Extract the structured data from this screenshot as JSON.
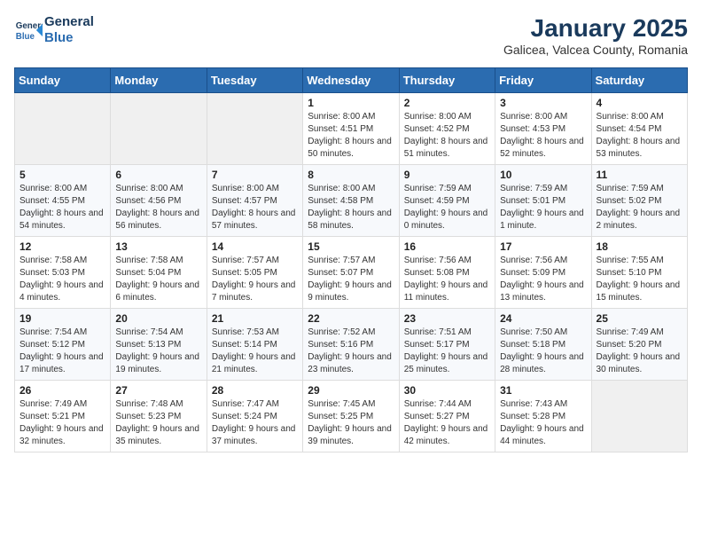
{
  "header": {
    "logo_line1": "General",
    "logo_line2": "Blue",
    "month": "January 2025",
    "location": "Galicea, Valcea County, Romania"
  },
  "weekdays": [
    "Sunday",
    "Monday",
    "Tuesday",
    "Wednesday",
    "Thursday",
    "Friday",
    "Saturday"
  ],
  "weeks": [
    [
      {
        "day": "",
        "sunrise": "",
        "sunset": "",
        "daylight": ""
      },
      {
        "day": "",
        "sunrise": "",
        "sunset": "",
        "daylight": ""
      },
      {
        "day": "",
        "sunrise": "",
        "sunset": "",
        "daylight": ""
      },
      {
        "day": "1",
        "sunrise": "8:00 AM",
        "sunset": "4:51 PM",
        "daylight": "8 hours and 50 minutes."
      },
      {
        "day": "2",
        "sunrise": "8:00 AM",
        "sunset": "4:52 PM",
        "daylight": "8 hours and 51 minutes."
      },
      {
        "day": "3",
        "sunrise": "8:00 AM",
        "sunset": "4:53 PM",
        "daylight": "8 hours and 52 minutes."
      },
      {
        "day": "4",
        "sunrise": "8:00 AM",
        "sunset": "4:54 PM",
        "daylight": "8 hours and 53 minutes."
      }
    ],
    [
      {
        "day": "5",
        "sunrise": "8:00 AM",
        "sunset": "4:55 PM",
        "daylight": "8 hours and 54 minutes."
      },
      {
        "day": "6",
        "sunrise": "8:00 AM",
        "sunset": "4:56 PM",
        "daylight": "8 hours and 56 minutes."
      },
      {
        "day": "7",
        "sunrise": "8:00 AM",
        "sunset": "4:57 PM",
        "daylight": "8 hours and 57 minutes."
      },
      {
        "day": "8",
        "sunrise": "8:00 AM",
        "sunset": "4:58 PM",
        "daylight": "8 hours and 58 minutes."
      },
      {
        "day": "9",
        "sunrise": "7:59 AM",
        "sunset": "4:59 PM",
        "daylight": "9 hours and 0 minutes."
      },
      {
        "day": "10",
        "sunrise": "7:59 AM",
        "sunset": "5:01 PM",
        "daylight": "9 hours and 1 minute."
      },
      {
        "day": "11",
        "sunrise": "7:59 AM",
        "sunset": "5:02 PM",
        "daylight": "9 hours and 2 minutes."
      }
    ],
    [
      {
        "day": "12",
        "sunrise": "7:58 AM",
        "sunset": "5:03 PM",
        "daylight": "9 hours and 4 minutes."
      },
      {
        "day": "13",
        "sunrise": "7:58 AM",
        "sunset": "5:04 PM",
        "daylight": "9 hours and 6 minutes."
      },
      {
        "day": "14",
        "sunrise": "7:57 AM",
        "sunset": "5:05 PM",
        "daylight": "9 hours and 7 minutes."
      },
      {
        "day": "15",
        "sunrise": "7:57 AM",
        "sunset": "5:07 PM",
        "daylight": "9 hours and 9 minutes."
      },
      {
        "day": "16",
        "sunrise": "7:56 AM",
        "sunset": "5:08 PM",
        "daylight": "9 hours and 11 minutes."
      },
      {
        "day": "17",
        "sunrise": "7:56 AM",
        "sunset": "5:09 PM",
        "daylight": "9 hours and 13 minutes."
      },
      {
        "day": "18",
        "sunrise": "7:55 AM",
        "sunset": "5:10 PM",
        "daylight": "9 hours and 15 minutes."
      }
    ],
    [
      {
        "day": "19",
        "sunrise": "7:54 AM",
        "sunset": "5:12 PM",
        "daylight": "9 hours and 17 minutes."
      },
      {
        "day": "20",
        "sunrise": "7:54 AM",
        "sunset": "5:13 PM",
        "daylight": "9 hours and 19 minutes."
      },
      {
        "day": "21",
        "sunrise": "7:53 AM",
        "sunset": "5:14 PM",
        "daylight": "9 hours and 21 minutes."
      },
      {
        "day": "22",
        "sunrise": "7:52 AM",
        "sunset": "5:16 PM",
        "daylight": "9 hours and 23 minutes."
      },
      {
        "day": "23",
        "sunrise": "7:51 AM",
        "sunset": "5:17 PM",
        "daylight": "9 hours and 25 minutes."
      },
      {
        "day": "24",
        "sunrise": "7:50 AM",
        "sunset": "5:18 PM",
        "daylight": "9 hours and 28 minutes."
      },
      {
        "day": "25",
        "sunrise": "7:49 AM",
        "sunset": "5:20 PM",
        "daylight": "9 hours and 30 minutes."
      }
    ],
    [
      {
        "day": "26",
        "sunrise": "7:49 AM",
        "sunset": "5:21 PM",
        "daylight": "9 hours and 32 minutes."
      },
      {
        "day": "27",
        "sunrise": "7:48 AM",
        "sunset": "5:23 PM",
        "daylight": "9 hours and 35 minutes."
      },
      {
        "day": "28",
        "sunrise": "7:47 AM",
        "sunset": "5:24 PM",
        "daylight": "9 hours and 37 minutes."
      },
      {
        "day": "29",
        "sunrise": "7:45 AM",
        "sunset": "5:25 PM",
        "daylight": "9 hours and 39 minutes."
      },
      {
        "day": "30",
        "sunrise": "7:44 AM",
        "sunset": "5:27 PM",
        "daylight": "9 hours and 42 minutes."
      },
      {
        "day": "31",
        "sunrise": "7:43 AM",
        "sunset": "5:28 PM",
        "daylight": "9 hours and 44 minutes."
      },
      {
        "day": "",
        "sunrise": "",
        "sunset": "",
        "daylight": ""
      }
    ]
  ],
  "labels": {
    "sunrise": "Sunrise:",
    "sunset": "Sunset:",
    "daylight": "Daylight:"
  }
}
